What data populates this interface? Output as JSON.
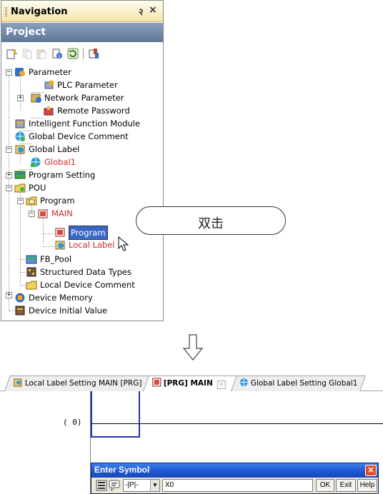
{
  "navigation": {
    "title": "Navigation",
    "pin_glyph": "२",
    "close_glyph": "×",
    "section": "Project",
    "toolbar": [
      "new-data-icon",
      "copy-icon",
      "paste-icon",
      "property-icon",
      "refresh-icon",
      "find-icon"
    ],
    "tree": {
      "parameter": "Parameter",
      "plc_parameter": "PLC Parameter",
      "network_parameter": "Network Parameter",
      "remote_password": "Remote Password",
      "intelligent_function_module": "Intelligent Function Module",
      "global_device_comment": "Global Device Comment",
      "global_label": "Global Label",
      "global1": "Global1",
      "program_setting": "Program Setting",
      "pou": "POU",
      "program": "Program",
      "main": "MAIN",
      "main_program": "Program",
      "local_label": "Local Label",
      "fb_pool": "FB_Pool",
      "structured_data_types": "Structured Data Types",
      "local_device_comment": "Local Device Comment",
      "device_memory": "Device Memory",
      "device_initial_value": "Device Initial Value"
    },
    "expanders": {
      "minus": "−",
      "plus": "+"
    }
  },
  "callout": {
    "text": "双击"
  },
  "editor": {
    "tabs": [
      {
        "label": "Local Label Setting MAIN [PRG]"
      },
      {
        "label": "[PRG] MAIN"
      },
      {
        "label": "Global Label Setting Global1"
      }
    ],
    "tab_close_glyph": "×",
    "step_label": "(   0)",
    "enter_symbol": {
      "title": "Enter Symbol",
      "close_glyph": "×",
      "instruction": "-|P|-",
      "input_value": "X0",
      "ok_label": "OK",
      "exit_label": "Exit",
      "help_label": "Help"
    }
  },
  "colors": {
    "project_bar": "#6f86a8",
    "title_bar": "#f6e4a8",
    "red_label": "#cc2a2a",
    "selection": "#3a66c4",
    "dialog_title": "#1e56d0",
    "cursor_box": "#2633a4"
  }
}
